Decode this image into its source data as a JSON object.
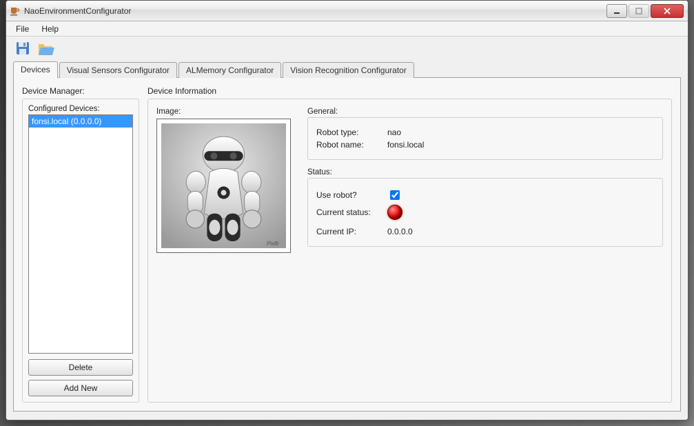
{
  "window": {
    "title": "NaoEnvironmentConfigurator"
  },
  "menubar": {
    "file": "File",
    "help": "Help"
  },
  "toolbar": {
    "save_icon": "save-icon",
    "open_icon": "open-folder-icon"
  },
  "tabs": [
    {
      "label": "Devices",
      "active": true
    },
    {
      "label": "Visual Sensors Configurator",
      "active": false
    },
    {
      "label": "ALMemory Configurator",
      "active": false
    },
    {
      "label": "Vision Recognition Configurator",
      "active": false
    }
  ],
  "device_manager": {
    "title": "Device Manager:",
    "configured_label": "Configured Devices:",
    "items": [
      {
        "label": "fonsi.local (0.0.0.0)",
        "selected": true
      }
    ],
    "delete_label": "Delete",
    "add_label": "Add New"
  },
  "device_info": {
    "title": "Device Information",
    "image_label": "Image:",
    "general": {
      "title": "General:",
      "robot_type_label": "Robot type:",
      "robot_type_value": "nao",
      "robot_name_label": "Robot name:",
      "robot_name_value": "fonsi.local"
    },
    "status": {
      "title": "Status:",
      "use_robot_label": "Use robot?",
      "use_robot_checked": true,
      "current_status_label": "Current status:",
      "status_color": "red",
      "current_ip_label": "Current IP:",
      "current_ip_value": "0.0.0.0"
    }
  }
}
